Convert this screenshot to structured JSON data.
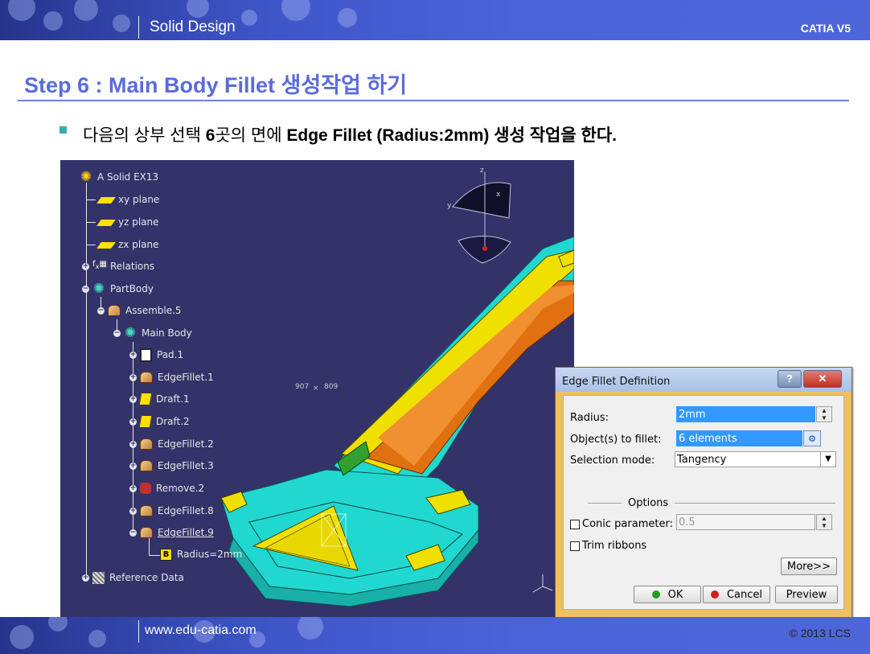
{
  "header": {
    "left_title": "Solid Design",
    "right_title": "CATIA V5"
  },
  "slide": {
    "title": "Step 6 : Main Body Fillet 생성작업 하기",
    "instruction_parts": [
      "다음의 상부 선택 ",
      "6",
      "곳의 면에 ",
      "Edge Fillet (Radius:2mm)",
      " 생성 작업을 한다."
    ]
  },
  "tree": {
    "root": "A Solid EX13",
    "items": [
      {
        "label": "xy plane",
        "icon": "plane-icon"
      },
      {
        "label": "yz plane",
        "icon": "plane-icon"
      },
      {
        "label": "zx plane",
        "icon": "plane-icon"
      },
      {
        "label": "Relations",
        "icon": "relations-icon"
      },
      {
        "label": "PartBody",
        "icon": "gear-icon"
      },
      {
        "label": "Assemble.5",
        "icon": "assemble-icon"
      },
      {
        "label": "Main Body",
        "icon": "gear-icon"
      },
      {
        "label": "Pad.1",
        "icon": "pad-icon"
      },
      {
        "label": "EdgeFillet.1",
        "icon": "fillet-icon"
      },
      {
        "label": "Draft.1",
        "icon": "draft-icon"
      },
      {
        "label": "Draft.2",
        "icon": "draft-icon"
      },
      {
        "label": "EdgeFillet.2",
        "icon": "fillet-icon"
      },
      {
        "label": "EdgeFillet.3",
        "icon": "fillet-icon"
      },
      {
        "label": "Remove.2",
        "icon": "remove-icon"
      },
      {
        "label": "EdgeFillet.8",
        "icon": "fillet-icon"
      },
      {
        "label": "EdgeFillet.9",
        "icon": "fillet-icon"
      },
      {
        "label": "Radius=2mm",
        "icon": "parameter-icon"
      },
      {
        "label": "Reference Data",
        "icon": "reference-icon"
      }
    ]
  },
  "viewport": {
    "coord_x": "907",
    "coord_y": "809",
    "coord_sep": "×",
    "compass_x": "x",
    "compass_y": "y",
    "compass_z": "z"
  },
  "dialog": {
    "title": "Edge Fillet Definition",
    "help_label": "?",
    "close_label": "✕",
    "radius_label": "Radius:",
    "radius_value": "2mm",
    "objects_label": "Object(s) to fillet:",
    "objects_value": "6 elements",
    "selection_mode_label": "Selection mode:",
    "selection_mode_value": "Tangency",
    "options_label": "Options",
    "conic_label": "Conic parameter:",
    "conic_value": "0.5",
    "trim_label": "Trim ribbons",
    "more_label": "More>>",
    "ok_label": "OK",
    "cancel_label": "Cancel",
    "preview_label": "Preview"
  },
  "footer": {
    "website": "www.edu-catia.com",
    "copyright": "© 2013 LCS"
  },
  "colors": {
    "accent": "#5a6cdc",
    "viewport_bg": "#33336a",
    "part_cyan": "#20d8d0",
    "part_yellow": "#f0e000",
    "part_orange": "#e07010",
    "dialog_frame": "#f0c060"
  }
}
